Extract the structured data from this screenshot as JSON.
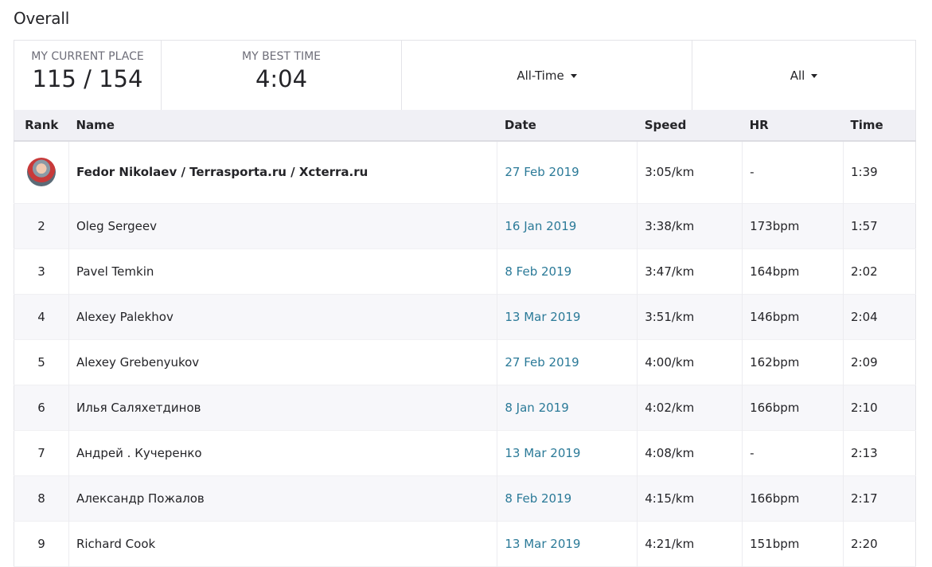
{
  "page": {
    "title": "Overall"
  },
  "summary": {
    "place_label": "MY CURRENT PLACE",
    "place_value": "115 / 154",
    "best_label": "MY BEST TIME",
    "best_value": "4:04",
    "time_filter": "All-Time",
    "type_filter": "All"
  },
  "table": {
    "headers": {
      "rank": "Rank",
      "name": "Name",
      "date": "Date",
      "speed": "Speed",
      "hr": "HR",
      "time": "Time"
    },
    "rows": [
      {
        "rank": "",
        "name": "Fedor Nikolaev / Terrasporta.ru / Xcterra.ru",
        "date": "27 Feb 2019",
        "speed": "3:05/km",
        "hr": "-",
        "time": "1:39"
      },
      {
        "rank": "2",
        "name": "Oleg Sergeev",
        "date": "16 Jan 2019",
        "speed": "3:38/km",
        "hr": "173bpm",
        "time": "1:57"
      },
      {
        "rank": "3",
        "name": "Pavel Temkin",
        "date": "8 Feb 2019",
        "speed": "3:47/km",
        "hr": "164bpm",
        "time": "2:02"
      },
      {
        "rank": "4",
        "name": "Alexey Palekhov",
        "date": "13 Mar 2019",
        "speed": "3:51/km",
        "hr": "146bpm",
        "time": "2:04"
      },
      {
        "rank": "5",
        "name": "Alexey Grebenyukov",
        "date": "27 Feb 2019",
        "speed": "4:00/km",
        "hr": "162bpm",
        "time": "2:09"
      },
      {
        "rank": "6",
        "name": "Илья Саляхетдинов",
        "date": "8 Jan 2019",
        "speed": "4:02/km",
        "hr": "166bpm",
        "time": "2:10"
      },
      {
        "rank": "7",
        "name": "Андрей . Кучеренко",
        "date": "13 Mar 2019",
        "speed": "4:08/km",
        "hr": "-",
        "time": "2:13"
      },
      {
        "rank": "8",
        "name": "Александр Пожалов",
        "date": "8 Feb 2019",
        "speed": "4:15/km",
        "hr": "166bpm",
        "time": "2:17"
      },
      {
        "rank": "9",
        "name": "Richard Cook",
        "date": "13 Mar 2019",
        "speed": "4:21/km",
        "hr": "151bpm",
        "time": "2:20"
      }
    ]
  }
}
